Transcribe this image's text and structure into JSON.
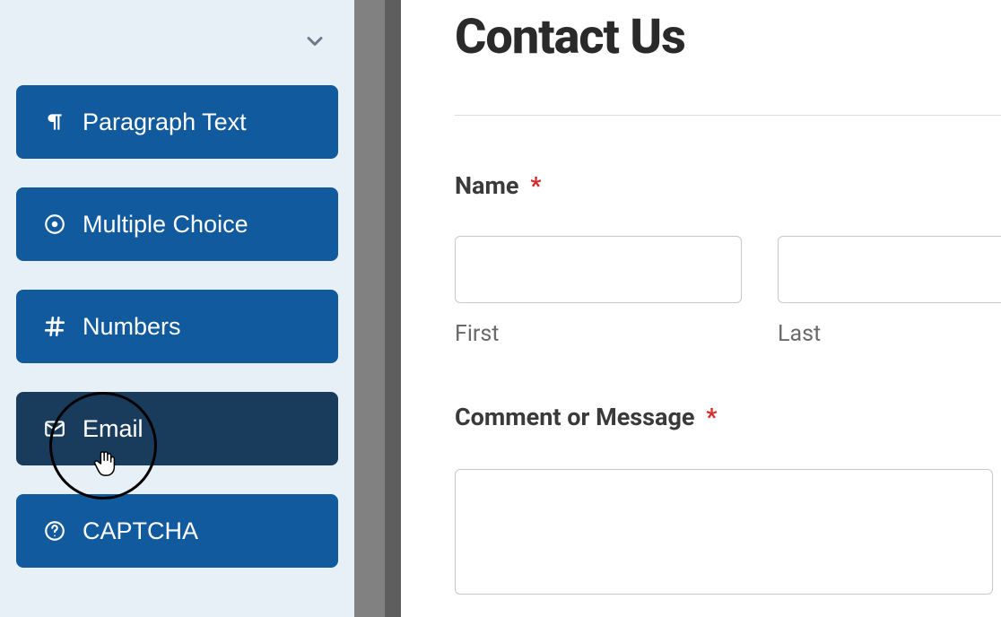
{
  "sidebar": {
    "fields": [
      {
        "label": "Paragraph Text",
        "icon": "pilcrow-icon",
        "hovered": false
      },
      {
        "label": "Multiple Choice",
        "icon": "radio-icon",
        "hovered": false
      },
      {
        "label": "Numbers",
        "icon": "hash-icon",
        "hovered": false
      },
      {
        "label": "Email",
        "icon": "envelope-icon",
        "hovered": true
      },
      {
        "label": "CAPTCHA",
        "icon": "question-circle-icon",
        "hovered": false
      }
    ]
  },
  "preview": {
    "title": "Contact Us",
    "name_label": "Name",
    "name_required": "*",
    "first_label": "First",
    "last_label": "Last",
    "comment_label": "Comment or Message",
    "comment_required": "*"
  },
  "colors": {
    "button_bg": "#125a9e",
    "button_hover": "#1a3c5c",
    "sidebar_bg": "#e7eff7",
    "required": "#d82a2a"
  }
}
